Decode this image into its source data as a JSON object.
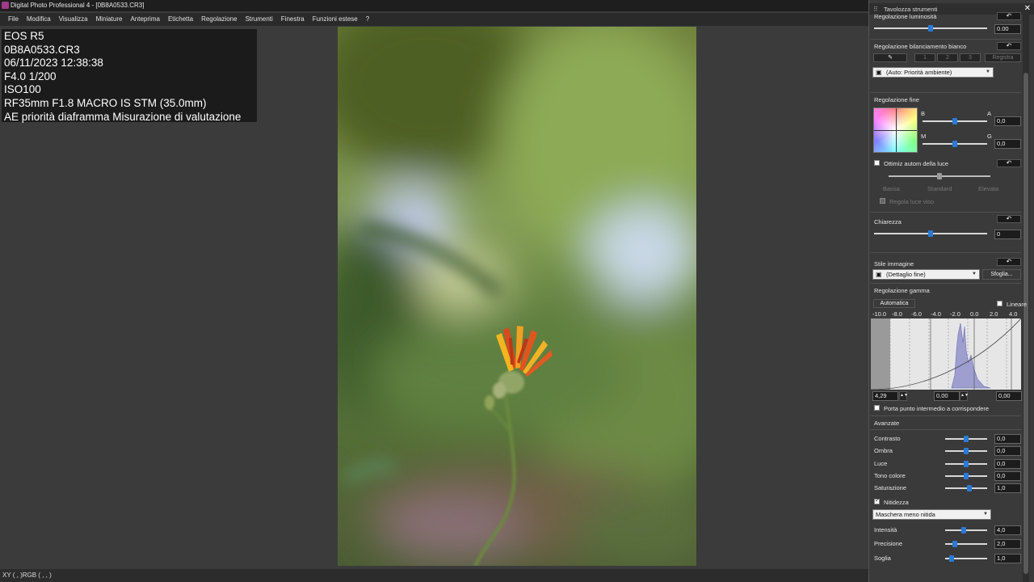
{
  "window": {
    "title": "Digital Photo Professional 4 - [0B8A0533.CR3]"
  },
  "menu": [
    "File",
    "Modifica",
    "Visualizza",
    "Miniature",
    "Anteprima",
    "Etichetta",
    "Regolazione",
    "Strumenti",
    "Finestra",
    "Funzioni estese",
    "?"
  ],
  "info": {
    "camera": "EOS R5",
    "file": "0B8A0533.CR3",
    "datetime": "06/11/2023 12:38:38",
    "exposure": "F4.0 1/200",
    "iso": "ISO100",
    "lens": "RF35mm F1.8 MACRO IS STM (35.0mm)",
    "mode": "AE priorità diaframma Misurazione di valutazione"
  },
  "status": {
    "xy": "XY (     ,     )RGB (     ,     ,     )"
  },
  "palette": {
    "title": "Tavolozza strumenti",
    "brightness": {
      "label": "Regolazione luminosità",
      "value": "0.00",
      "level": 0.5
    },
    "wb": {
      "label": "Regolazione bilanciamento bianco",
      "presets": [
        "1",
        "2",
        "3"
      ],
      "register": "Registra",
      "mode": "(Auto: Priorità ambiente)"
    },
    "fine": {
      "label": "Regolazione fine",
      "b": "B",
      "a": "A",
      "m": "M",
      "g": "G",
      "ba_value": "0,0",
      "mg_value": "0,0"
    },
    "alo": {
      "label": "Ottimiz autom della luce",
      "levels": [
        "Bassa",
        "Standard",
        "Elevata"
      ],
      "faces": "Regola luce viso"
    },
    "clarity": {
      "label": "Chiarezza",
      "value": "0",
      "level": 0.5
    },
    "style": {
      "label": "Stile immagine",
      "value": "(Dettaglio fine)",
      "browse": "Sfoglia..."
    },
    "gamma": {
      "label": "Regolazione gamma",
      "auto": "Automatica",
      "linear": "Lineare",
      "ticks": [
        "-10.0",
        "-8.0",
        "-6.0",
        "-4.0",
        "-2.0",
        "0.0",
        "2.0",
        "4.0"
      ],
      "low": "4,29",
      "mid": "0,00",
      "high": "0,00",
      "midpoint": "Porta punto intermedio a corrispondere"
    },
    "advanced": {
      "label": "Avanzate",
      "rows": [
        {
          "name": "Contrasto",
          "value": "0,0",
          "level": 0.5
        },
        {
          "name": "Ombra",
          "value": "0,0",
          "level": 0.5
        },
        {
          "name": "Luce",
          "value": "0,0",
          "level": 0.5
        },
        {
          "name": "Tono colore",
          "value": "0,0",
          "level": 0.5
        },
        {
          "name": "Saturazione",
          "value": "1,0",
          "level": 0.58
        }
      ]
    },
    "sharp": {
      "label": "Nitidezza",
      "mode": "Maschera meno nitida",
      "rows": [
        {
          "name": "Intensità",
          "value": "4,0",
          "level": 0.43
        },
        {
          "name": "Precisione",
          "value": "2,0",
          "level": 0.2
        },
        {
          "name": "Soglia",
          "value": "1,0",
          "level": 0.1
        }
      ]
    }
  }
}
